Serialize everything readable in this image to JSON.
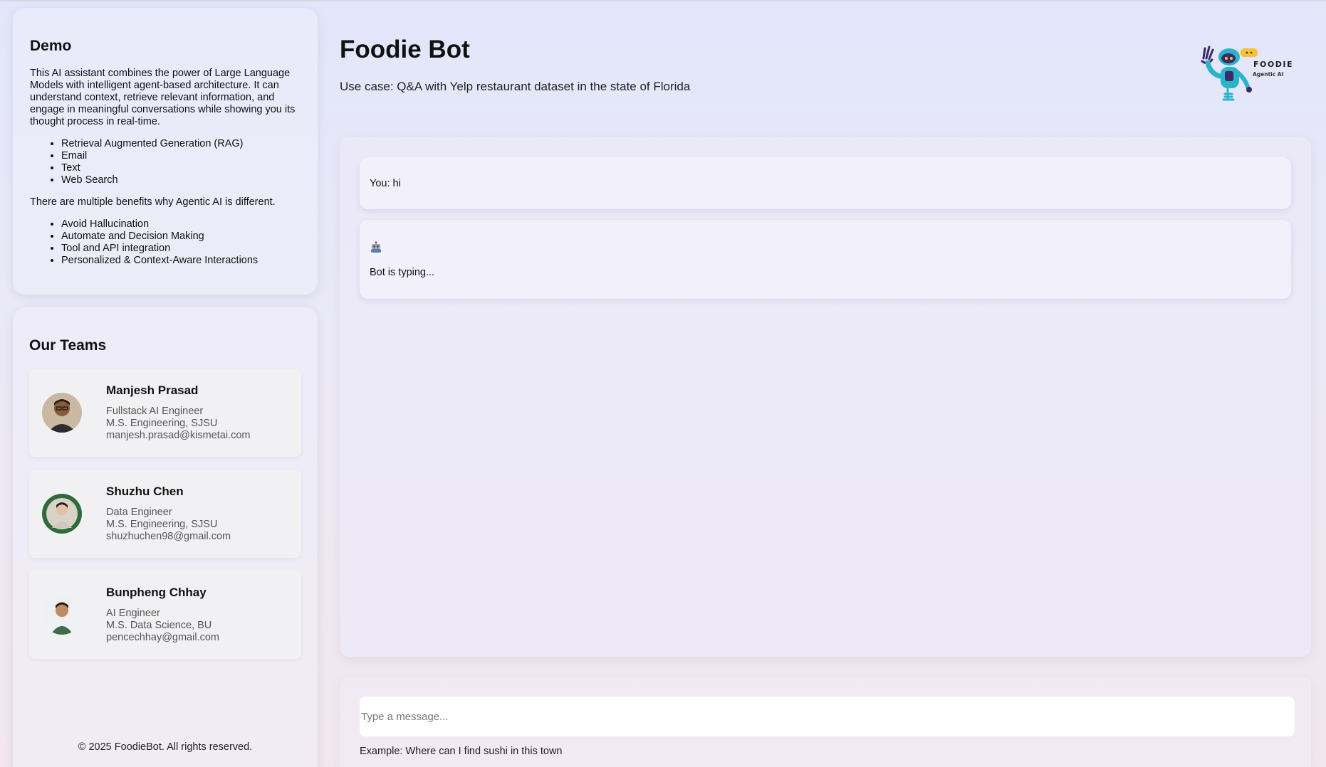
{
  "sidebar": {
    "demo": {
      "title": "Demo",
      "intro": "This AI assistant combines the power of Large Language Models with intelligent agent-based architecture. It can understand context, retrieve relevant information, and engage in meaningful conversations while showing you its thought process in real-time.",
      "features": [
        "Retrieval Augmented Generation (RAG)",
        "Email",
        "Text",
        "Web Search"
      ],
      "benefits_intro": "There are multiple benefits why Agentic AI is different.",
      "benefits": [
        "Avoid Hallucination",
        "Automate and Decision Making",
        "Tool and API integration",
        "Personalized & Context-Aware Interactions"
      ]
    },
    "teams": {
      "title": "Our Teams",
      "members": [
        {
          "name": "Manjesh Prasad",
          "role": "Fullstack AI Engineer",
          "education": "M.S. Engineering, SJSU",
          "email": "manjesh.prasad@kismetai.com"
        },
        {
          "name": "Shuzhu Chen",
          "role": "Data Engineer",
          "education": "M.S. Engineering, SJSU",
          "email": "shuzhuchen98@gmail.com"
        },
        {
          "name": "Bunpheng Chhay",
          "role": "AI Engineer",
          "education": "M.S. Data Science, BU",
          "email": "pencechhay@gmail.com"
        }
      ]
    },
    "footer": "© 2025 FoodieBot. All rights reserved."
  },
  "header": {
    "title": "Foodie Bot",
    "subtitle": "Use case: Q&A with Yelp restaurant dataset in the state of Florida",
    "logo": {
      "text": "FOODIE",
      "subtext": "Agentic AI",
      "icon": "robot-mascot"
    }
  },
  "chat": {
    "messages": [
      {
        "sender": "user",
        "text": "You: hi"
      },
      {
        "sender": "bot",
        "icon": "robot-icon",
        "text": "Bot is typing..."
      }
    ]
  },
  "composer": {
    "placeholder": "Type a message...",
    "value": "",
    "example": "Example: Where can I find sushi in this town"
  },
  "colors": {
    "accent_teal": "#2bb3c8",
    "accent_purple": "#3d2a66",
    "accent_yellow": "#f4c430"
  }
}
